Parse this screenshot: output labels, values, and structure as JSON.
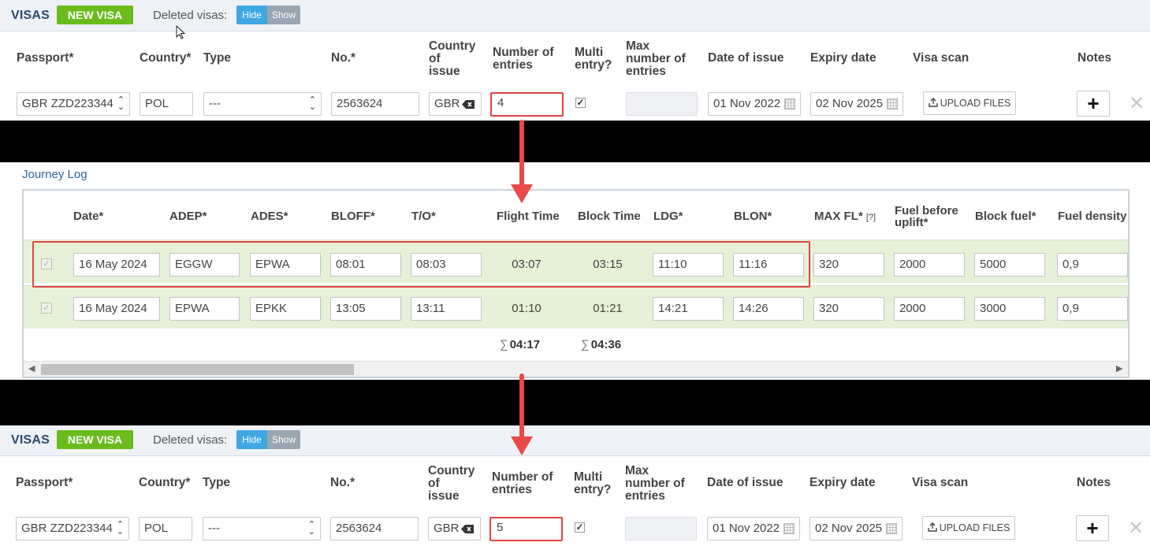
{
  "visas_top": {
    "title": "VISAS",
    "new_visa": "NEW VISA",
    "deleted_label": "Deleted visas:",
    "hide": "Hide",
    "show": "Show",
    "headers": {
      "passport": "Passport*",
      "country": "Country*",
      "type": "Type",
      "no": "No.*",
      "country_issue_1": "Country",
      "country_issue_2": "of",
      "country_issue_3": "issue",
      "entries_1": "Number of",
      "entries_2": "entries",
      "multi_1": "Multi",
      "multi_2": "entry?",
      "max_1": "Max",
      "max_2": "number of",
      "max_3": "entries",
      "date_issue": "Date of issue",
      "expiry": "Expiry date",
      "scan": "Visa scan",
      "notes": "Notes"
    },
    "row": {
      "passport": "GBR ZZD223344",
      "country": "POL",
      "type": "---",
      "no": "2563624",
      "country_issue": "GBR",
      "entries": "4",
      "multi_checked": true,
      "max_entries": "",
      "date_issue": "01 Nov 2022",
      "expiry": "02 Nov 2025",
      "upload": "UPLOAD FILES"
    }
  },
  "journey": {
    "title": "Journey Log",
    "headers": {
      "date": "Date*",
      "adep": "ADEP*",
      "ades": "ADES*",
      "bloff": "BLOFF*",
      "to": "T/O*",
      "flight_time": "Flight Time",
      "block_time": "Block Time",
      "ldg": "LDG*",
      "blon": "BLON*",
      "max_fl": "MAX FL*",
      "max_fl_help": "[?]",
      "fuel_before_1": "Fuel before",
      "fuel_before_2": "uplift*",
      "block_fuel": "Block fuel*",
      "fuel_density": "Fuel density"
    },
    "rows": [
      {
        "date": "16 May 2024",
        "adep": "EGGW",
        "ades": "EPWA",
        "bloff": "08:01",
        "to": "08:03",
        "flight_time": "03:07",
        "block_time": "03:15",
        "ldg": "11:10",
        "blon": "11:16",
        "max_fl": "320",
        "fuel_before": "2000",
        "block_fuel": "5000",
        "density": "0,9"
      },
      {
        "date": "16 May 2024",
        "adep": "EPWA",
        "ades": "EPKK",
        "bloff": "13:05",
        "to": "13:11",
        "flight_time": "01:10",
        "block_time": "01:21",
        "ldg": "14:21",
        "blon": "14:26",
        "max_fl": "320",
        "fuel_before": "2000",
        "block_fuel": "3000",
        "density": "0,9"
      }
    ],
    "sum_symbol": "∑",
    "sum_flight": "04:17",
    "sum_block": "04:36"
  },
  "visas_bottom": {
    "title": "VISAS",
    "new_visa": "NEW VISA",
    "deleted_label": "Deleted visas:",
    "hide": "Hide",
    "show": "Show",
    "row": {
      "passport": "GBR ZZD223344",
      "country": "POL",
      "type": "---",
      "no": "2563624",
      "country_issue": "GBR",
      "entries": "5",
      "multi_checked": true,
      "max_entries": "",
      "date_issue": "01 Nov 2022",
      "expiry": "02 Nov 2025",
      "upload": "UPLOAD FILES"
    }
  },
  "icons": {
    "select": "select-arrows-icon",
    "calendar": "calendar-icon",
    "upload": "upload-icon",
    "clear": "backspace-icon",
    "plus": "plus-icon",
    "close": "close-icon",
    "check": "checkmark-icon",
    "arrow": "down-arrow-icon"
  },
  "colors": {
    "accent_green": "#6cbb1d",
    "hide_blue": "#3fa7e2",
    "highlight_red": "#e04545",
    "row_green": "#e6f1d8"
  }
}
